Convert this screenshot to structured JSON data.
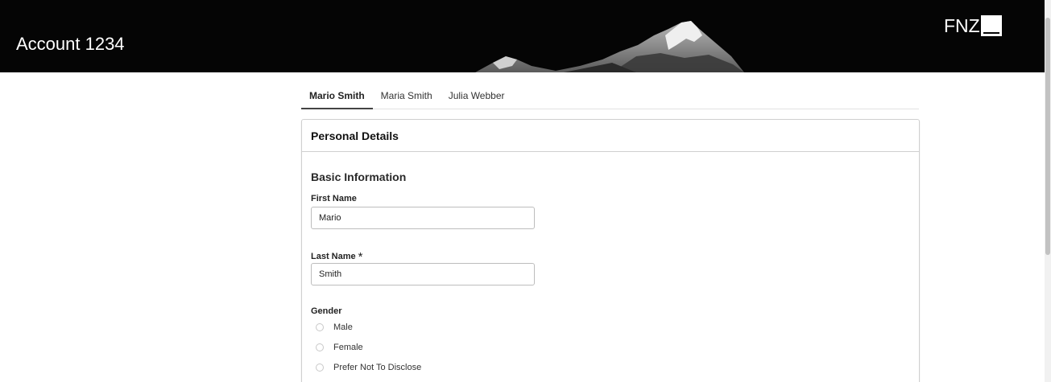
{
  "header": {
    "account_title": "Account 1234",
    "logo_text": "FNZ"
  },
  "tabs": [
    {
      "label": "Mario Smith",
      "active": true
    },
    {
      "label": "Maria Smith",
      "active": false
    },
    {
      "label": "Julia Webber",
      "active": false
    }
  ],
  "card": {
    "title": "Personal Details",
    "section_title": "Basic Information",
    "first_name": {
      "label": "First Name",
      "value": "Mario"
    },
    "last_name": {
      "label": "Last Name",
      "required_mark": "*",
      "value": "Smith"
    },
    "gender": {
      "label": "Gender",
      "options": [
        {
          "label": "Male",
          "selected": false
        },
        {
          "label": "Female",
          "selected": false
        },
        {
          "label": "Prefer Not To Disclose",
          "selected": false
        }
      ]
    }
  },
  "colors": {
    "banner_bg": "#050505",
    "text_primary": "#222222",
    "border": "#cfcfcf"
  }
}
